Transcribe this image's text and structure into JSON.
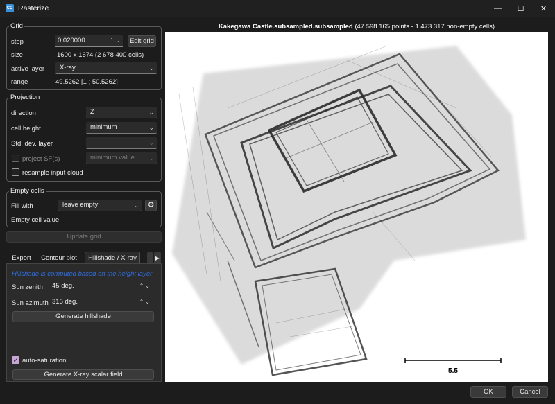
{
  "window": {
    "title": "Rasterize",
    "icon_text": "CC"
  },
  "grid": {
    "title": "Grid",
    "step_label": "step",
    "step_value": "0.020000",
    "edit_grid_label": "Edit grid",
    "size_label": "size",
    "size_value": "1600 x 1674 (2 678 400 cells)",
    "active_layer_label": "active layer",
    "active_layer_value": "X-ray",
    "range_label": "range",
    "range_value": "49.5262 [1 ; 50.5262]"
  },
  "projection": {
    "title": "Projection",
    "direction_label": "direction",
    "direction_value": "Z",
    "cell_height_label": "cell height",
    "cell_height_value": "minimum",
    "std_dev_label": "Std. dev. layer",
    "std_dev_value": "",
    "project_sf_label": "project SF(s)",
    "project_sf_value": "minimum value",
    "resample_label": "resample input cloud"
  },
  "empty_cells": {
    "title": "Empty cells",
    "fill_with_label": "Fill with",
    "fill_with_value": "leave empty",
    "empty_value_label": "Empty cell value"
  },
  "update_grid_label": "Update grid",
  "tabs": [
    {
      "label": "Export"
    },
    {
      "label": "Contour plot"
    },
    {
      "label": "Hillshade / X-ray"
    }
  ],
  "hillshade": {
    "info": "Hillshade is computed based on the height layer",
    "sun_zenith_label": "Sun zenith",
    "sun_zenith_value": "45 deg.",
    "sun_azimuth_label": "Sun azimuth",
    "sun_azimuth_value": "315 deg.",
    "generate_hillshade_label": "Generate hillshade",
    "auto_saturation_label": "auto-saturation",
    "generate_xray_label": "Generate X-ray scalar field"
  },
  "viewport": {
    "cloud_name": "Kakegawa Castle.subsampled.subsampled",
    "cloud_info": "(47 598 165 points - 1 473 317 non-empty cells)",
    "scale_value": "5.5"
  },
  "footer": {
    "ok_label": "OK",
    "cancel_label": "Cancel"
  },
  "colors": {
    "info_text": "#2f6fe0",
    "checkbox_checked": "#c9a6d8",
    "background": "#1c1c1c"
  }
}
